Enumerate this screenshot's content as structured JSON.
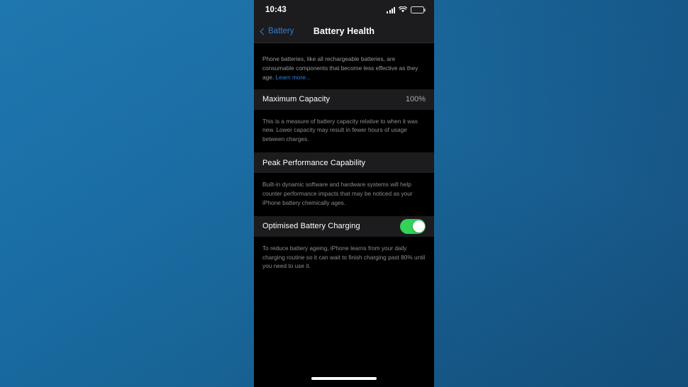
{
  "background": {
    "color_top_left": "#1a72ab",
    "color_bottom_right": "#164f7c"
  },
  "phone": {
    "status_bar": {
      "time": "10:43",
      "icons": [
        "cellular-signal-icon",
        "wifi-icon",
        "battery-icon"
      ]
    },
    "nav_bar": {
      "back_label": "Battery",
      "back_icon": "chevron-left-icon",
      "title": "Battery Health",
      "tint_color": "#2f7fd6"
    },
    "intro": {
      "text": "Phone batteries, like all rechargeable batteries, are consumable components that become less effective as they age. ",
      "link_label": "Learn more..."
    },
    "sections": [
      {
        "label": "Maximum Capacity",
        "value": "100%",
        "note": "This is a measure of battery capacity relative to when it was new. Lower capacity may result in fewer hours of usage between charges."
      },
      {
        "label": "Peak Performance Capability",
        "value": "",
        "note": "Built-in dynamic software and hardware systems will help counter performance impacts that may be noticed as your iPhone battery chemically ages."
      },
      {
        "label": "Optimised Battery Charging",
        "toggle_on": true,
        "toggle_color": "#32d158",
        "note": "To reduce battery ageing, iPhone learns from your daily charging routine so it can wait to finish charging past 80% until you need to use it."
      }
    ],
    "home_indicator": "home-indicator"
  }
}
